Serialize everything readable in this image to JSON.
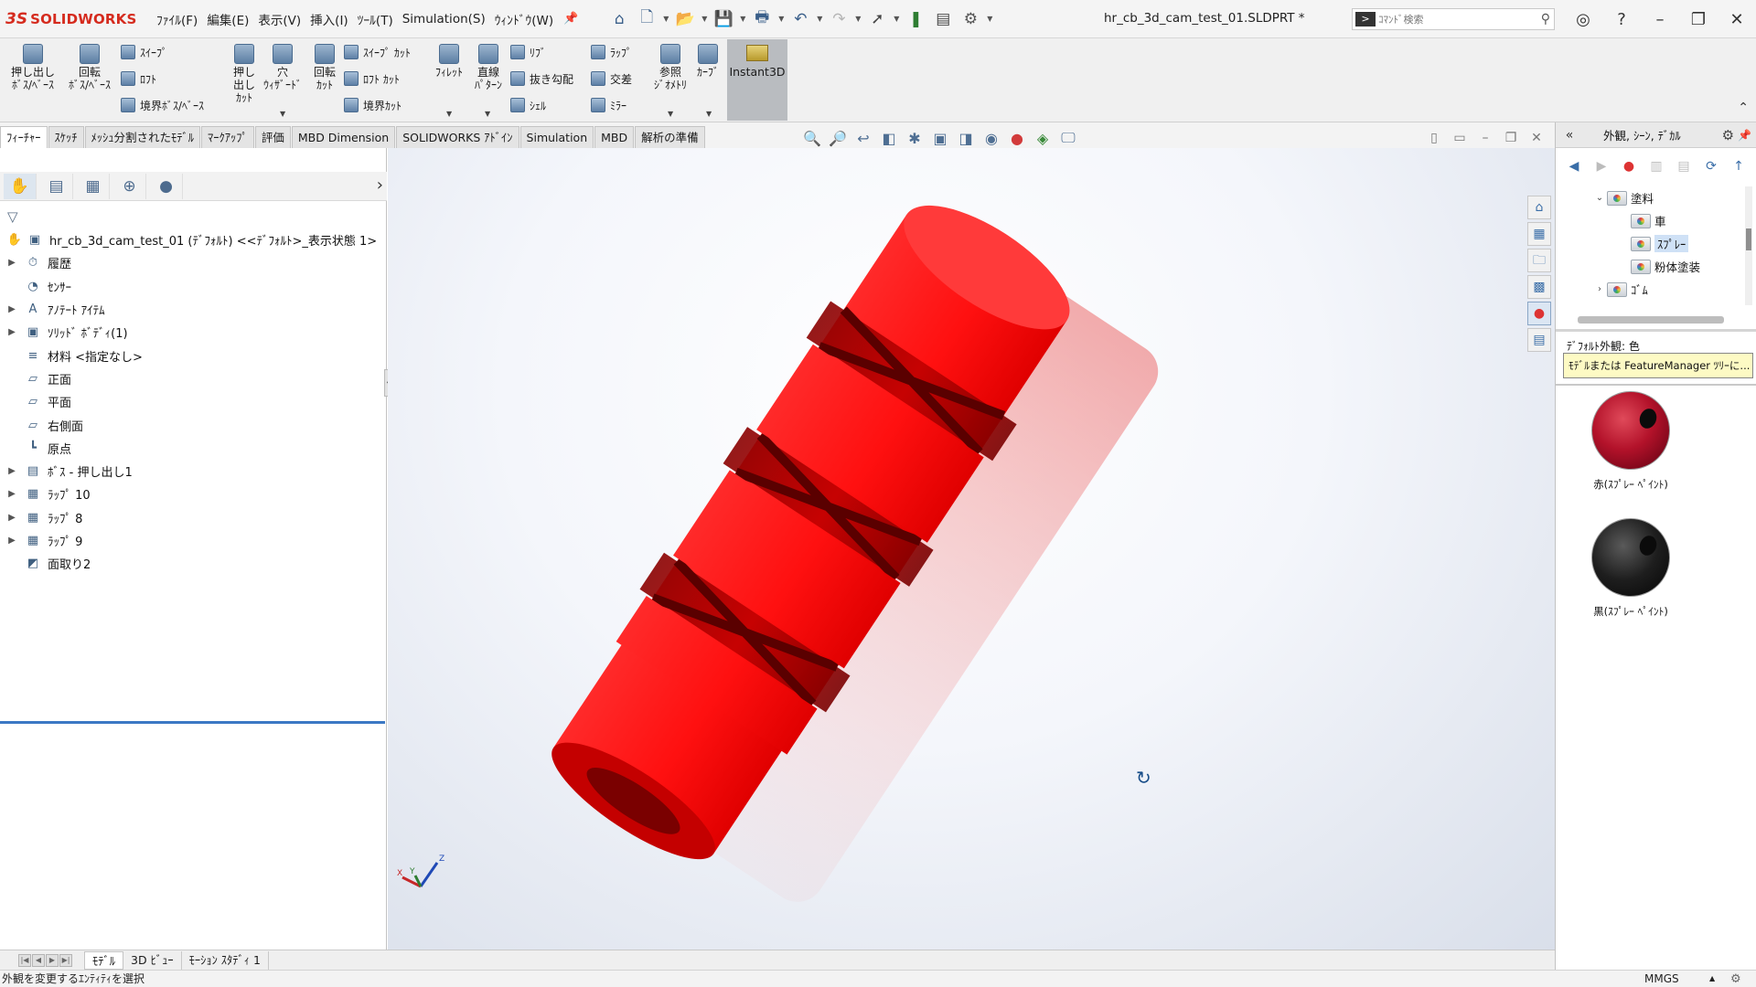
{
  "app": {
    "brand_ds": "3S",
    "brand_name": "SOLIDWORKS",
    "document_title": "hr_cb_3d_cam_test_01.SLDPRT *",
    "command_search_placeholder": "ｺﾏﾝﾄﾞ検索"
  },
  "menus": [
    "ﾌｧｲﾙ(F)",
    "編集(E)",
    "表示(V)",
    "挿入(I)",
    "ﾂｰﾙ(T)",
    "Simulation(S)",
    "ｳｨﾝﾄﾞｳ(W)"
  ],
  "ribbon": {
    "extruded_boss": "押し出し\nﾎﾞｽ/ﾍﾞｰｽ",
    "revolved_boss": "回転\nﾎﾞｽ/ﾍﾞｰｽ",
    "sweep": "ｽｲｰﾌﾟ",
    "loft": "ﾛﾌﾄ",
    "boundary_boss": "境界ﾎﾞｽ/ﾍﾞｰｽ",
    "extruded_cut": "押し\n出し\nｶｯﾄ",
    "hole_wizard": "穴\nｳｨｻﾞｰﾄﾞ",
    "revolved_cut": "回転\nｶｯﾄ",
    "swept_cut": "ｽｲｰﾌﾟ ｶｯﾄ",
    "lofted_cut": "ﾛﾌﾄ ｶｯﾄ",
    "boundary_cut": "境界ｶｯﾄ",
    "fillet": "ﾌｨﾚｯﾄ",
    "linear_pattern": "直線\nﾊﾟﾀｰﾝ",
    "rib": "ﾘﾌﾞ",
    "draft": "抜き勾配",
    "shell": "ｼｪﾙ",
    "wrap": "ﾗｯﾌﾟ",
    "intersect": "交差",
    "mirror": "ﾐﾗｰ",
    "reference_geometry": "参照\nｼﾞｵﾒﾄﾘ",
    "curves": "ｶｰﾌﾞ",
    "instant3d": "Instant3D"
  },
  "command_tabs": [
    "ﾌｨｰﾁｬｰ",
    "ｽｹｯﾁ",
    "ﾒｯｼｭ分割されたﾓﾃﾞﾙ",
    "ﾏｰｸｱｯﾌﾟ",
    "評価",
    "MBD Dimension",
    "SOLIDWORKS ｱﾄﾞｲﾝ",
    "Simulation",
    "MBD",
    "解析の準備"
  ],
  "feature_tree": {
    "root": "hr_cb_3d_cam_test_01 (ﾃﾞﾌｫﾙﾄ) <<ﾃﾞﾌｫﾙﾄ>_表示状態 1>",
    "items": [
      {
        "label": "履歴",
        "icon": "history-icon",
        "expandable": true
      },
      {
        "label": "ｾﾝｻｰ",
        "icon": "sensor-icon",
        "expandable": false
      },
      {
        "label": "ｱﾉﾃｰﾄ ｱｲﾃﾑ",
        "icon": "annotation-icon",
        "expandable": true
      },
      {
        "label": "ｿﾘｯﾄﾞ ﾎﾞﾃﾞｨ(1)",
        "icon": "solid-body-icon",
        "expandable": true
      },
      {
        "label": "材料 <指定なし>",
        "icon": "material-icon",
        "expandable": false
      },
      {
        "label": "正面",
        "icon": "plane-icon",
        "expandable": false
      },
      {
        "label": "平面",
        "icon": "plane-icon",
        "expandable": false
      },
      {
        "label": "右側面",
        "icon": "plane-icon",
        "expandable": false
      },
      {
        "label": "原点",
        "icon": "origin-icon",
        "expandable": false
      },
      {
        "label": "ﾎﾞｽ - 押し出し1",
        "icon": "extrude-icon",
        "expandable": true
      },
      {
        "label": "ﾗｯﾌﾟ 10",
        "icon": "wrap-icon",
        "expandable": true
      },
      {
        "label": "ﾗｯﾌﾟ 8",
        "icon": "wrap-icon",
        "expandable": true
      },
      {
        "label": "ﾗｯﾌﾟ 9",
        "icon": "wrap-icon",
        "expandable": true
      },
      {
        "label": "面取り2",
        "icon": "chamfer-icon",
        "expandable": false
      }
    ]
  },
  "bottom_tabs": [
    "ﾓﾃﾞﾙ",
    "3D ﾋﾞｭｰ",
    "ﾓｰｼｮﾝ ｽﾀﾃﾞｨ 1"
  ],
  "status": {
    "message": "外観を変更するｴﾝﾃｨﾃｨを選択",
    "units": "MMGS"
  },
  "task_pane": {
    "title": "外観, ｼｰﾝ, ﾃﾞｶﾙ",
    "tree": [
      {
        "label": "塗料",
        "level": 0,
        "expanded": true
      },
      {
        "label": "車",
        "level": 1
      },
      {
        "label": "ｽﾌﾟﾚｰ",
        "level": 1,
        "selected": true
      },
      {
        "label": "粉体塗装",
        "level": 1
      },
      {
        "label": "ｺﾞﾑ",
        "level": 0,
        "expanded": false
      }
    ],
    "default_appearance_label": "ﾃﾞﾌｫﾙﾄ外観: 色",
    "tooltip": "ﾓﾃﾞﾙまたは FeatureManager ﾂﾘｰに...",
    "swatches": [
      {
        "label": "赤(ｽﾌﾟﾚｰ ﾍﾟｲﾝﾄ)",
        "color": "#c0142a"
      },
      {
        "label": "黒(ｽﾌﾟﾚｰ ﾍﾟｲﾝﾄ)",
        "color": "#151515"
      }
    ]
  },
  "colors": {
    "brand": "#d52b1e",
    "model_red": "#ff1a1a",
    "selection_blue": "#3b78c4",
    "tooltip_yellow": "#fdfac4"
  }
}
